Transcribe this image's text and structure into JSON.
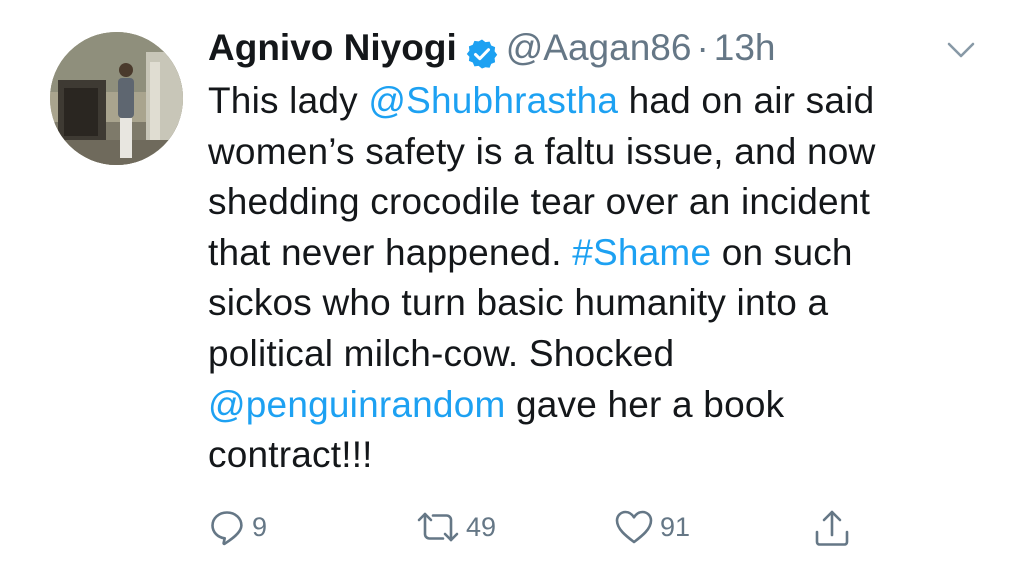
{
  "user": {
    "display_name": "Agnivo Niyogi",
    "handle": "@Aagan86",
    "separator": "·",
    "time": "13h"
  },
  "tweet": {
    "lines": [
      [
        {
          "t": "This lady "
        },
        {
          "t": "@Shubhrastha",
          "link": true
        },
        {
          "t": " had on air said"
        }
      ],
      [
        {
          "t": "women’s safety is a faltu issue, and now"
        }
      ],
      [
        {
          "t": "shedding crocodile tear over an incident"
        }
      ],
      [
        {
          "t": "that never happened. "
        },
        {
          "t": "#Shame",
          "link": true
        },
        {
          "t": " on such"
        }
      ],
      [
        {
          "t": "sickos who turn basic humanity into a"
        }
      ],
      [
        {
          "t": "political milch-cow. Shocked"
        }
      ],
      [
        {
          "t": "@penguinrandom",
          "link": true
        },
        {
          "t": " gave her a book"
        }
      ],
      [
        {
          "t": "contract!!!"
        }
      ]
    ]
  },
  "actions": {
    "reply": {
      "icon": "reply-icon",
      "count": "9"
    },
    "retweet": {
      "icon": "retweet-icon",
      "count": "49"
    },
    "like": {
      "icon": "heart-icon",
      "count": "91"
    },
    "share": {
      "icon": "share-icon"
    }
  },
  "colors": {
    "text": "#14171a",
    "secondary": "#657786",
    "link": "#1da1f2",
    "verified": "#1da1f2"
  }
}
